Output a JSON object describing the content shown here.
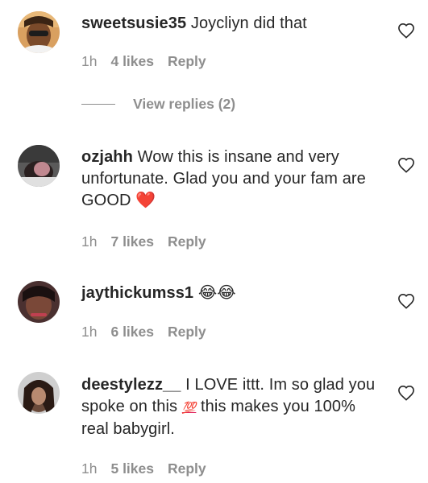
{
  "comments": [
    {
      "username": "sweetsusie35",
      "text": " Joycliyn did that",
      "time": "1h",
      "likes": "4 likes",
      "reply": "Reply",
      "view_replies": "View replies (2)"
    },
    {
      "username": "ozjahh",
      "text": " Wow this is insane and very unfortunate. Glad you and your fam are GOOD ",
      "emoji": "❤️",
      "time": "1h",
      "likes": "7 likes",
      "reply": "Reply"
    },
    {
      "username": "jaythickumss1",
      "text": " ",
      "emoji": "😂😂",
      "time": "1h",
      "likes": "6 likes",
      "reply": "Reply"
    },
    {
      "username": "deestylezz__",
      "text_before": " I LOVE ittt. Im so glad you spoke on this ",
      "emoji": "💯",
      "text_after": " this makes you 100% real babygirl.",
      "time": "1h",
      "likes": "5 likes",
      "reply": "Reply"
    }
  ],
  "icons": {
    "like": "heart-outline-icon"
  },
  "colors": {
    "text": "#262626",
    "muted": "#8e8e8e",
    "heart": "#e0245e"
  }
}
